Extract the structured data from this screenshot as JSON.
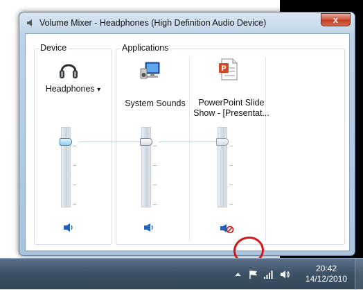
{
  "window": {
    "title": "Volume Mixer - Headphones (High Definition Audio Device)",
    "close_glyph": "x"
  },
  "device_group": {
    "label": "Device",
    "device_name": "Headphones",
    "dropdown_glyph": "▾",
    "device_icon": "headphones-icon",
    "volume_fraction": 1.0,
    "muted": false
  },
  "applications_group": {
    "label": "Applications",
    "apps": [
      {
        "name": "System Sounds",
        "icon": "system-sounds-icon",
        "volume_fraction": 1.0,
        "muted": false
      },
      {
        "name": "PowerPoint Slide Show - [Presentat...",
        "name_line1": "PowerPoint Slide",
        "name_line2": "Show - [Presentat...",
        "icon": "powerpoint-icon",
        "volume_fraction": 1.0,
        "muted": true
      }
    ]
  },
  "taskbar": {
    "time": "20:42",
    "date": "14/12/2010",
    "tray_icons": [
      "arrow-up-icon",
      "flag-icon",
      "network-icon",
      "speaker-icon"
    ]
  },
  "colors": {
    "mute_red": "#d31616",
    "speaker_blue": "#1f63b8",
    "taskbar": "#3f5368"
  }
}
